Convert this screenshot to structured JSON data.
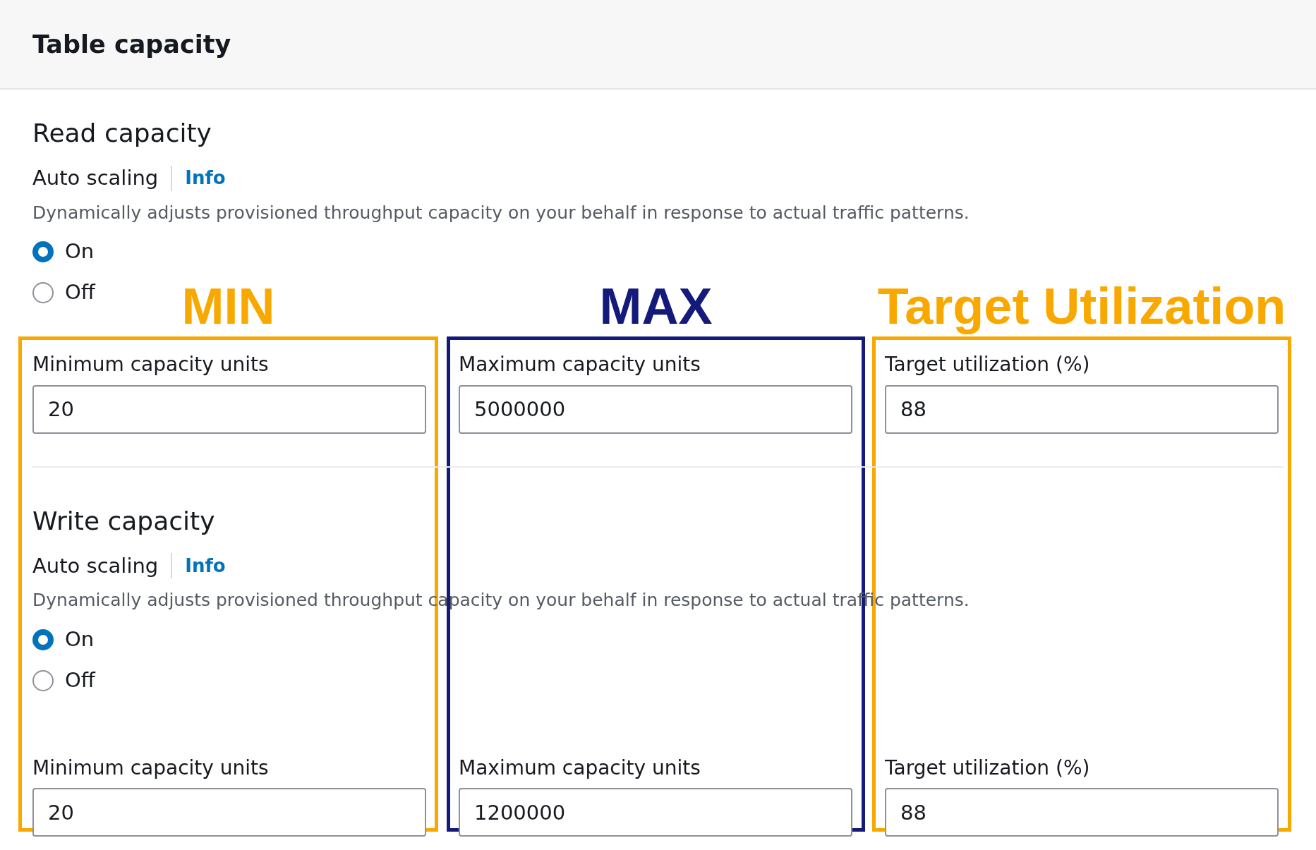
{
  "header": {
    "title": "Table capacity"
  },
  "sections": [
    {
      "title": "Read capacity",
      "setting": "Auto scaling",
      "info": "Info",
      "description": "Dynamically adjusts provisioned throughput capacity on your behalf in response to actual traffic patterns.",
      "options": [
        {
          "label": "On",
          "selected": true
        },
        {
          "label": "Off",
          "selected": false
        }
      ],
      "fields": [
        {
          "label": "Minimum capacity units",
          "value": "20"
        },
        {
          "label": "Maximum capacity units",
          "value": "5000000"
        },
        {
          "label": "Target utilization (%)",
          "value": "88"
        }
      ]
    },
    {
      "title": "Write capacity",
      "setting": "Auto scaling",
      "info": "Info",
      "description": "Dynamically adjusts provisioned throughput capacity on your behalf in response to actual traffic patterns.",
      "options": [
        {
          "label": "On",
          "selected": true
        },
        {
          "label": "Off",
          "selected": false
        }
      ],
      "fields": [
        {
          "label": "Minimum capacity units",
          "value": "20"
        },
        {
          "label": "Maximum capacity units",
          "value": "1200000"
        },
        {
          "label": "Target utilization (%)",
          "value": "88"
        }
      ]
    }
  ],
  "annotations": [
    {
      "label": "MIN",
      "color": "#f9a800"
    },
    {
      "label": "MAX",
      "color": "#141a7a"
    },
    {
      "label": "Target Utilization",
      "color": "#f9a800"
    }
  ]
}
